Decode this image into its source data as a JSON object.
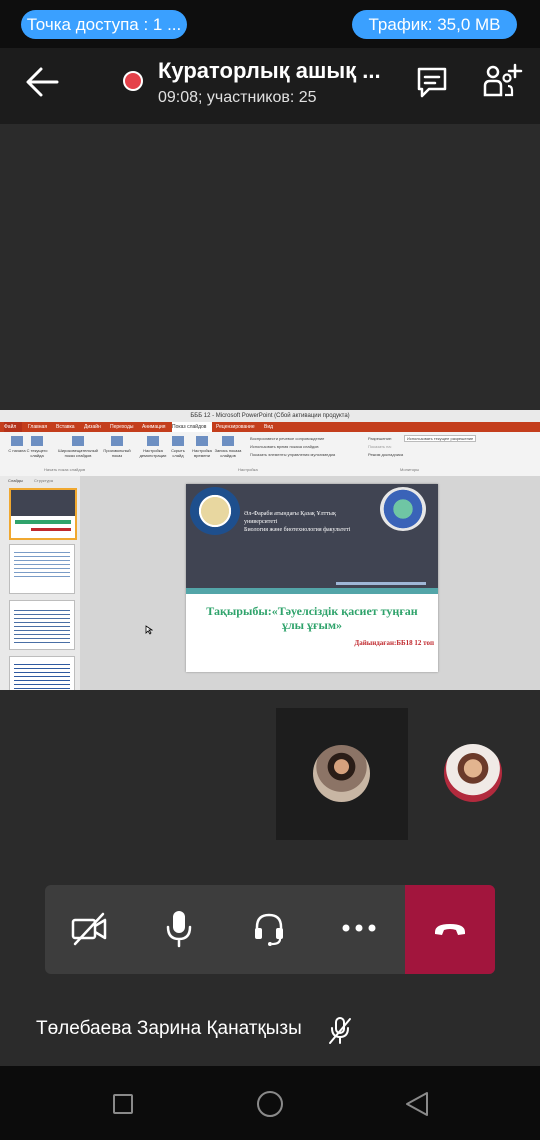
{
  "status_bar": {
    "hotspot_label": "Точка доступа : 1 ...",
    "traffic_label": "Трафик: 35,0 MB"
  },
  "call_header": {
    "title": "Кураторлық ашық ...",
    "subtitle": "09:08; участников: 25"
  },
  "shared_screen": {
    "window_title": "БББ 12 - Microsoft PowerPoint (Сбой активации продукта)",
    "ribbon_tabs": [
      "Файл",
      "Главная",
      "Вставка",
      "Дизайн",
      "Переходы",
      "Анимация",
      "Показ слайдов",
      "Рецензирование",
      "Вид"
    ],
    "active_tab_index": 6,
    "ribbon_buttons": [
      "С начала",
      "С текущего слайда",
      "Широковещательный показ слайдов",
      "Произвольный показ",
      "Настройка демонстрации",
      "Скрыть слайд",
      "Настройка времени",
      "Запись показа слайдов"
    ],
    "ribbon_options": [
      "Воспроизвести речевое сопровождение",
      "Использовать время показа слайдов",
      "Показать элементы управления мультимедиа"
    ],
    "ribbon_monitor": [
      "Разрешение:",
      "Использовать текущее разрешение",
      "Показать на:",
      "Режим докладчика"
    ],
    "ribbon_groups": [
      "Начать показ слайдов",
      "Настройка",
      "Мониторы"
    ],
    "panel_tabs": [
      "Слайды",
      "Структура"
    ],
    "slide": {
      "org_line_1": "Әл-Фараби атындағы Қазақ Ұлттық",
      "org_line_2": "университеті",
      "org_line_3": "Биология және биотехнология факультеті",
      "topic": "Тақырыбы:«Тәуелсіздік қасиет туңған ұлы ұғым»",
      "author": "Дайындаған:ББ18 12 топ"
    }
  },
  "bottom": {
    "speaker_name": "Төлебаева Зарина Қанатқызы"
  },
  "colors": {
    "hotspot_pill": "#3aa0ff",
    "record_dot": "#e5414a",
    "hangup": "#a2153d",
    "slide_topic": "#2fa36b",
    "slide_author": "#c0282d",
    "ppt_accent": "#c43e1c"
  },
  "icons": {
    "back": "back-arrow-icon",
    "record": "record-dot-icon",
    "chat": "chat-icon",
    "add_participant": "add-participant-icon",
    "camera_off": "camera-off-icon",
    "microphone": "microphone-icon",
    "headset": "headset-icon",
    "more": "more-icon",
    "hangup": "hangup-icon",
    "muted_mic": "mic-muted-icon"
  }
}
